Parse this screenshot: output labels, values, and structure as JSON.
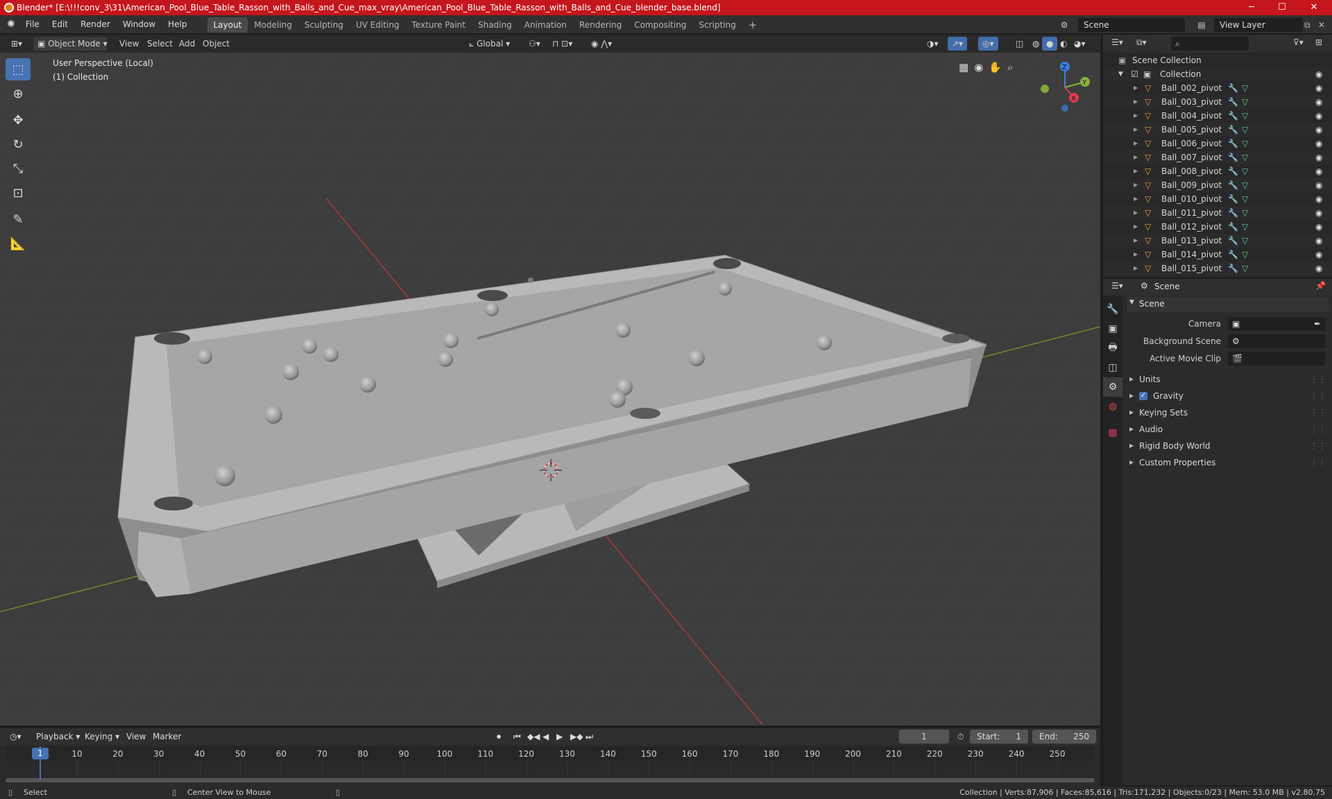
{
  "titlebar": {
    "title": "Blender* [E:\\!!!conv_3\\31\\American_Pool_Blue_Table_Rasson_with_Balls_and_Cue_max_vray\\American_Pool_Blue_Table_Rasson_with_Balls_and_Cue_blender_base.blend]",
    "minimize": "─",
    "maximize": "☐",
    "close": "✕"
  },
  "menu": {
    "items": [
      "File",
      "Edit",
      "Render",
      "Window",
      "Help"
    ]
  },
  "workspaces": {
    "tabs": [
      "Layout",
      "Modeling",
      "Sculpting",
      "UV Editing",
      "Texture Paint",
      "Shading",
      "Animation",
      "Rendering",
      "Compositing",
      "Scripting"
    ],
    "active": "Layout",
    "add": "+"
  },
  "scene_selector": {
    "label": "Scene"
  },
  "viewlayer_selector": {
    "label": "View Layer"
  },
  "viewport_header": {
    "mode": "Object Mode",
    "view": "View",
    "select": "Select",
    "add": "Add",
    "object": "Object",
    "orientation": "Global"
  },
  "viewport": {
    "perspective": "User Perspective (Local)",
    "collection": "(1) Collection"
  },
  "gizmo": {
    "z": "Z",
    "y": "Y",
    "x": "X"
  },
  "outliner": {
    "root": "Scene Collection",
    "collection": "Collection",
    "items": [
      "Ball_002_pivot",
      "Ball_003_pivot",
      "Ball_004_pivot",
      "Ball_005_pivot",
      "Ball_006_pivot",
      "Ball_007_pivot",
      "Ball_008_pivot",
      "Ball_009_pivot",
      "Ball_010_pivot",
      "Ball_011_pivot",
      "Ball_012_pivot",
      "Ball_013_pivot",
      "Ball_014_pivot",
      "Ball_015_pivot"
    ]
  },
  "properties": {
    "header": "Scene",
    "panel": "Scene",
    "camera_label": "Camera",
    "background_label": "Background Scene",
    "movieclip_label": "Active Movie Clip",
    "sections": [
      "Units",
      "Gravity",
      "Keying Sets",
      "Audio",
      "Rigid Body World",
      "Custom Properties"
    ],
    "gravity_checked": true
  },
  "timeline": {
    "playback": "Playback",
    "keying": "Keying",
    "view": "View",
    "marker": "Marker",
    "current_frame": "1",
    "start_label": "Start:",
    "start": "1",
    "end_label": "End:",
    "end": "250",
    "ticks": [
      "1",
      "10",
      "20",
      "30",
      "40",
      "50",
      "60",
      "70",
      "80",
      "90",
      "100",
      "110",
      "120",
      "130",
      "140",
      "150",
      "160",
      "170",
      "180",
      "190",
      "200",
      "210",
      "220",
      "230",
      "240",
      "250"
    ]
  },
  "statusbar": {
    "select": "Select",
    "center": "Center View to Mouse",
    "stats": "Collection | Verts:87,906 | Faces:85,616 | Tris:171,232 | Objects:0/23 | Mem: 53.0 MB | v2.80.75"
  },
  "colors": {
    "title_red": "#c4161c",
    "accent_blue": "#4772b3",
    "x_axis": "#e23c4f",
    "y_axis": "#8bb33a",
    "z_axis": "#3c7fe0",
    "object_orange": "#e8a23c",
    "modifier_blue": "#6e9ee6",
    "mesh_green": "#5ec9a0"
  }
}
